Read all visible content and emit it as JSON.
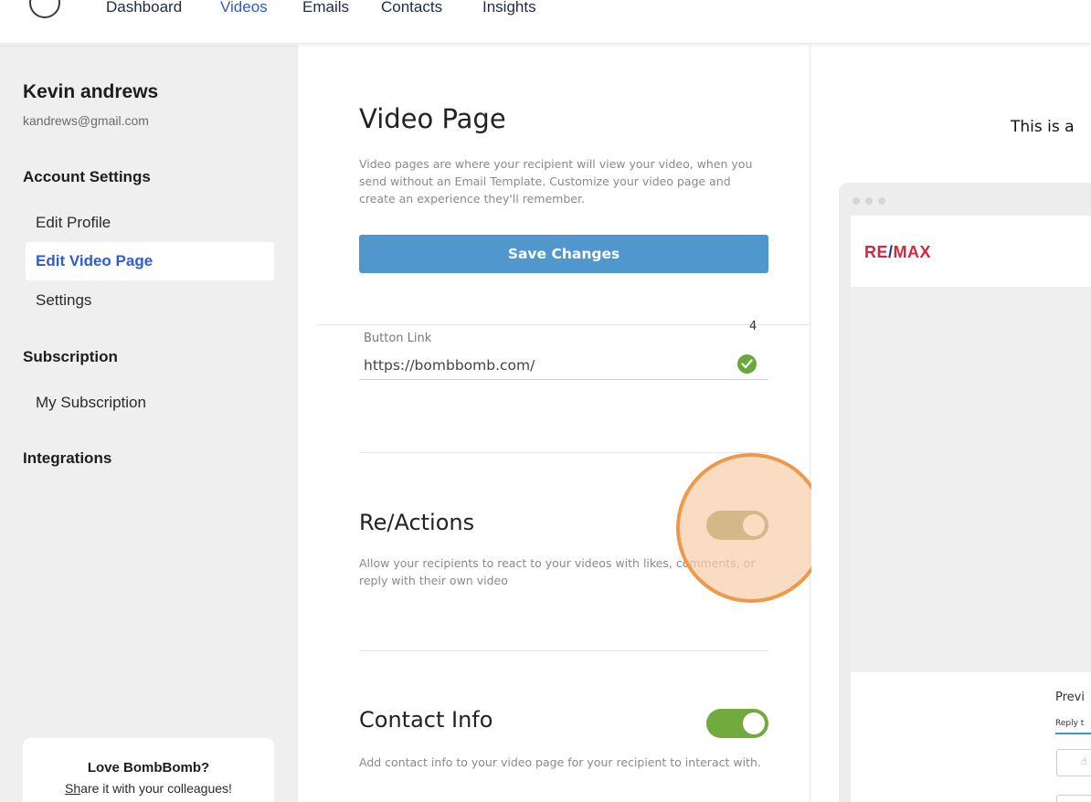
{
  "nav": {
    "items": [
      "Dashboard",
      "Videos",
      "Emails",
      "Contacts",
      "Insights"
    ],
    "active": "Videos"
  },
  "sidebar": {
    "user_name": "Kevin andrews",
    "user_email": "kandrews@gmail.com",
    "account_heading": "Account Settings",
    "account_items": [
      "Edit Profile",
      "Edit Video Page",
      "Settings"
    ],
    "active_item": "Edit Video Page",
    "subscription_heading": "Subscription",
    "subscription_items": [
      "My Subscription"
    ],
    "integrations_heading": "Integrations",
    "promo": {
      "title": "Love BombBomb?",
      "subtitle_underlined": "Sh",
      "subtitle_rest": "are it with your colleagues!"
    }
  },
  "main": {
    "title": "Video Page",
    "description": "Video pages are where your recipient will view your video, when you send without an Email Template. Customize your video page and create an experience they'll remember.",
    "save_label": "Save Changes",
    "counter": "4",
    "button_link": {
      "label": "Button Link",
      "value": "https://bombbomb.com/"
    },
    "reactions": {
      "title": "Re/Actions",
      "description": "Allow your recipients to react to your videos with likes, comments, or reply with their own video",
      "enabled": true
    },
    "contact_info": {
      "title": "Contact Info",
      "description": "Add contact info to your video page for your recipient to interact with.",
      "enabled": true
    }
  },
  "preview": {
    "heading": "This is a",
    "brand": {
      "left": "RE",
      "slash": "/",
      "right": "MAX"
    },
    "preview_label": "Previ",
    "reply_label": "Reply t"
  },
  "colors": {
    "accent": "#2f5bd3",
    "save_button": "#4f97cc",
    "toggle_on": "#72ab3d",
    "toggle_highlighted": "#7a7d30",
    "highlight_ring": "#ec9a4a",
    "success_check": "#6aa83b",
    "brand_red": "#d7263d",
    "brand_blue": "#143c8a"
  }
}
